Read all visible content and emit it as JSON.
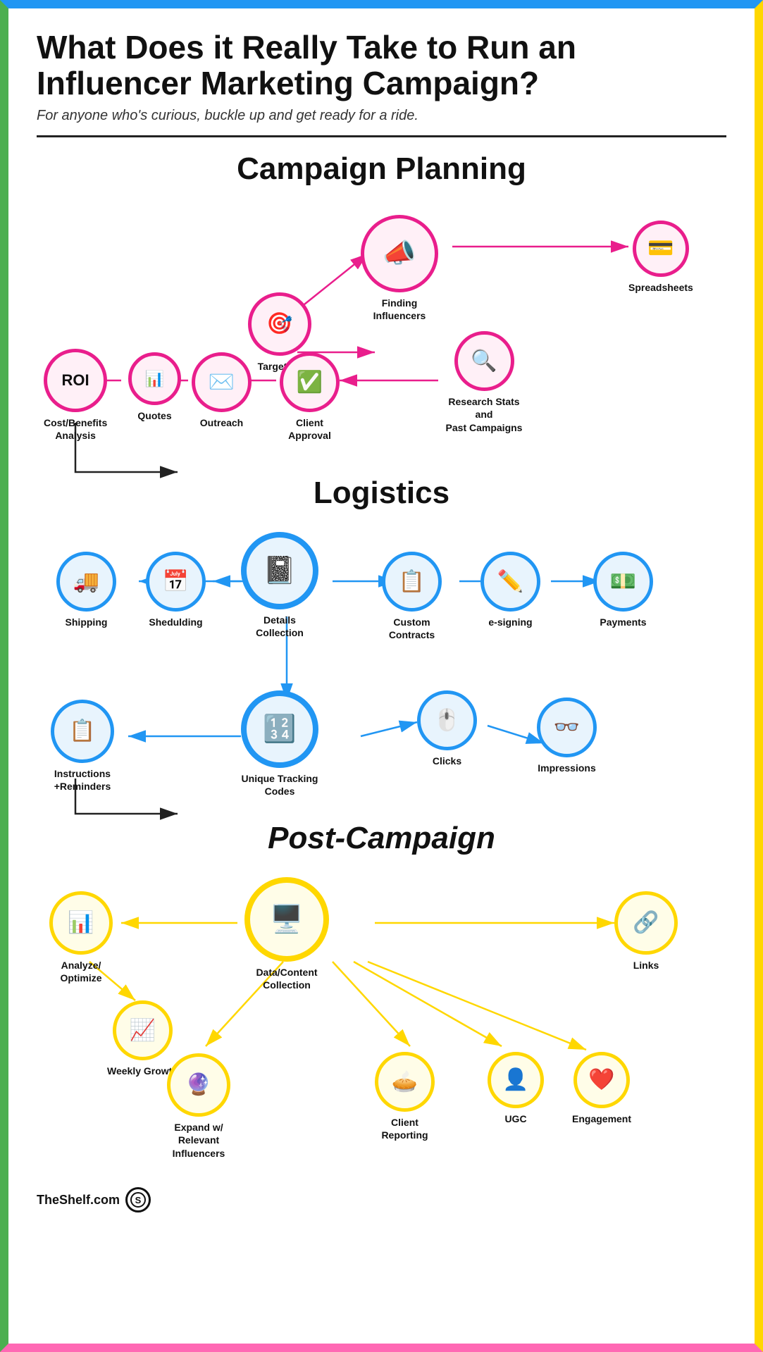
{
  "header": {
    "title": "What Does it Really Take to Run an Influencer Marketing Campaign?",
    "subtitle": "For anyone who's curious, buckle up and get ready for a ride."
  },
  "sections": {
    "campaign_planning": {
      "title": "Campaign Planning",
      "nodes": [
        {
          "id": "targeting",
          "label": "Targeting",
          "icon": "🎯",
          "theme": "pink"
        },
        {
          "id": "finding",
          "label": "Finding\nInfluencers",
          "icon": "📣",
          "theme": "pink"
        },
        {
          "id": "spreadsheets",
          "label": "Spreadsheets",
          "icon": "💳",
          "theme": "pink"
        },
        {
          "id": "research",
          "label": "Research Stats and\nPast Campaigns",
          "icon": "🔍",
          "theme": "pink"
        },
        {
          "id": "approval",
          "label": "Client\nApproval",
          "icon": "✅",
          "theme": "pink"
        },
        {
          "id": "outreach",
          "label": "Outreach",
          "icon": "✉️",
          "theme": "pink"
        },
        {
          "id": "quotes",
          "label": "Quotes",
          "icon": "📊",
          "theme": "pink"
        },
        {
          "id": "roi",
          "label": "Cost/Benefits\nAnalysis",
          "icon": "ROI",
          "theme": "pink"
        }
      ]
    },
    "logistics": {
      "title": "Logistics",
      "nodes": [
        {
          "id": "details",
          "label": "Details Collection",
          "icon": "📓",
          "theme": "blue"
        },
        {
          "id": "shipping",
          "label": "Shipping",
          "icon": "🚚",
          "theme": "blue"
        },
        {
          "id": "scheduling",
          "label": "Shedulding",
          "icon": "📅",
          "theme": "blue"
        },
        {
          "id": "contracts",
          "label": "Custom\nContracts",
          "icon": "📋",
          "theme": "blue"
        },
        {
          "id": "esigning",
          "label": "e-signing",
          "icon": "✏️",
          "theme": "blue"
        },
        {
          "id": "payments",
          "label": "Payments",
          "icon": "💵",
          "theme": "blue"
        },
        {
          "id": "tracking",
          "label": "Unique Tracking\nCodes",
          "icon": "🔢",
          "theme": "blue"
        },
        {
          "id": "clicks",
          "label": "Clicks",
          "icon": "🖱️",
          "theme": "blue"
        },
        {
          "id": "impressions",
          "label": "Impressions",
          "icon": "👓",
          "theme": "blue"
        },
        {
          "id": "instructions",
          "label": "Instructions\n+Reminders",
          "icon": "📋",
          "theme": "blue"
        }
      ]
    },
    "post_campaign": {
      "title": "Post-Campaign",
      "nodes": [
        {
          "id": "datacollection",
          "label": "Data/Content\nCollection",
          "icon": "🖥️",
          "theme": "yellow"
        },
        {
          "id": "analyze",
          "label": "Analyze/\nOptimize",
          "icon": "📊",
          "theme": "yellow"
        },
        {
          "id": "links",
          "label": "Links",
          "icon": "🔗",
          "theme": "yellow"
        },
        {
          "id": "weeklygrowth",
          "label": "Weekly Growth",
          "icon": "📈",
          "theme": "yellow"
        },
        {
          "id": "expand",
          "label": "Expand w/\nRelevant Influencers",
          "icon": "🔮",
          "theme": "yellow"
        },
        {
          "id": "clientreporting",
          "label": "Client\nReporting",
          "icon": "🥧",
          "theme": "yellow"
        },
        {
          "id": "ugc",
          "label": "UGC",
          "icon": "👤",
          "theme": "yellow"
        },
        {
          "id": "engagement",
          "label": "Engagement",
          "icon": "❤️",
          "theme": "yellow"
        }
      ]
    }
  },
  "footer": {
    "brand": "TheShelf.com"
  }
}
